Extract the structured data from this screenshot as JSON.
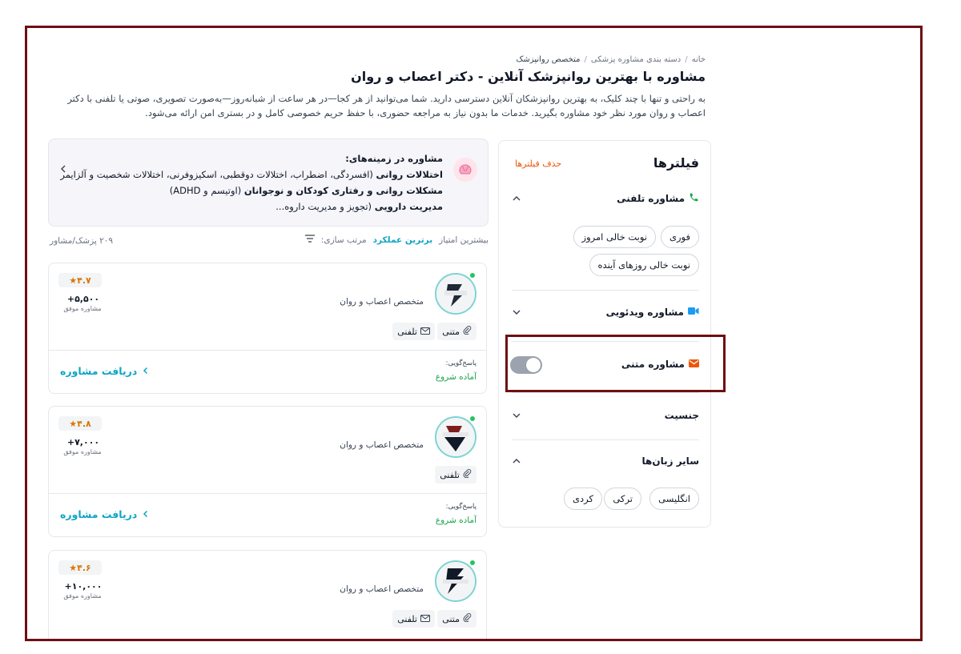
{
  "breadcrumb": {
    "home": "خانه",
    "category": "دسته بندی مشاوره پزشکی",
    "current": "متخصص روانپزشک"
  },
  "page_title": "مشاوره با بهترین روانپزشک آنلاین - دکتر اعصاب و روان",
  "intro": "به راحتی و تنها با چند کلیک، به بهترین روانپزشکان آنلاین دسترسی دارید. شما می‌توانید از هر کجا—در هر ساعت از شبانه‌روز—به‌صورت تصویری، صوتی یا تلفنی با دکتر اعصاب و روان مورد نظر خود مشاوره بگیرید. خدمات ما بدون نیاز به مراجعه حضوری، با حفظ حریم خصوصی کامل و در بستری امن ارائه می‌شود.",
  "filters": {
    "title": "فیلترها",
    "clear": "حذف فیلترها",
    "phone": {
      "label": "مشاوره تلفنی",
      "chips": [
        "فوری",
        "نوبت خالی امروز",
        "نوبت خالی روزهای آینده"
      ]
    },
    "video": {
      "label": "مشاوره ویدئویی"
    },
    "text": {
      "label": "مشاوره متنی",
      "toggle_on": false
    },
    "gender": {
      "label": "جنسیت"
    },
    "languages": {
      "label": "سایر زبان‌ها",
      "chips": [
        "انگلیسی",
        "ترکی",
        "کردی"
      ]
    }
  },
  "info": {
    "title": "مشاوره در زمینه‌های:",
    "line1_bold": "اختلالات روانی",
    "line1_rest": " (افسردگی، اضطراب، اختلالات دوقطبی، اسکیزوفرنی، اختلالات شخصیت و آلزایمر",
    "line2_bold": "مشکلات روانی و رفتاری کودکان و نوجوانان",
    "line2_rest": " (اوتیسم و ADHD)",
    "line3_bold": "مدیریت دارویی",
    "line3_rest": " (تجویز و مدیریت داروه..."
  },
  "sort": {
    "label": "مرتب سازی:",
    "top": "برترین عملکرد",
    "most": "بیشترین امتیاز",
    "count": "۲۰۹ پزشک/مشاور"
  },
  "cards": [
    {
      "rating": "۴.۷",
      "successful": "+۵,۵۰۰",
      "successful_label": "مشاوره موفق",
      "specialty": "متخصص اعصاب و روان",
      "badges": [
        "متنی",
        "تلفنی"
      ],
      "response_label": "پاسخ‌گویی:",
      "response_value": "آماده شروع",
      "cta": "دریافت مشاوره"
    },
    {
      "rating": "۴.۸",
      "successful": "+۷,۰۰۰",
      "successful_label": "مشاوره موفق",
      "specialty": "متخصص اعصاب و روان",
      "badges": [
        "تلفنی"
      ],
      "response_label": "پاسخ‌گویی:",
      "response_value": "آماده شروع",
      "cta": "دریافت مشاوره"
    },
    {
      "rating": "۴.۶",
      "successful": "+۱۰,۰۰۰",
      "successful_label": "مشاوره موفق",
      "specialty": "متخصص اعصاب و روان",
      "badges": [
        "متنی",
        "تلفنی"
      ]
    }
  ],
  "colors": {
    "frame": "#6e0f12",
    "accent": "#0ea5c6",
    "clear": "#ea580c",
    "green": "#16a34a",
    "star": "#d97706"
  }
}
